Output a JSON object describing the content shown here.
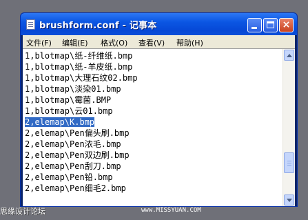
{
  "window": {
    "title": "brushform.conf - 记事本",
    "minimize_icon": "minimize-icon",
    "maximize_icon": "maximize-icon",
    "close_icon": "close-icon",
    "close_glyph": "×"
  },
  "menu": {
    "items": [
      "文件(F)",
      "编辑(E)",
      "格式(O)",
      "查看(V)",
      "帮助(H)"
    ]
  },
  "editor": {
    "lines": [
      "1,blotmap\\纸-纤维纸.bmp",
      "1,blotmap\\纸-羊皮纸.bmp",
      "1,blotmap\\大理石纹02.bmp",
      "1,blotmap\\淡染01.bmp",
      "1,blotmap\\霉菌.BMP",
      "1,blotmap\\云01.bmp",
      "2,elemap\\K.bmp",
      "2,elemap\\Pen偏头刷.bmp",
      "2,elemap\\Pen浓毛.bmp",
      "2,elemap\\Pen双边刷.bmp",
      "2,elemap\\Pen刮刀.bmp",
      "2,elemap\\Pen铅.bmp",
      "2,elemap\\Pen细毛2.bmp"
    ],
    "selected_line_index": 6
  },
  "watermarks": {
    "left": "思缘设计论坛",
    "right": "www.MISSYUAN.COM"
  },
  "colors": {
    "selection": "#316ac5",
    "titlebar": "#0b56e3"
  }
}
